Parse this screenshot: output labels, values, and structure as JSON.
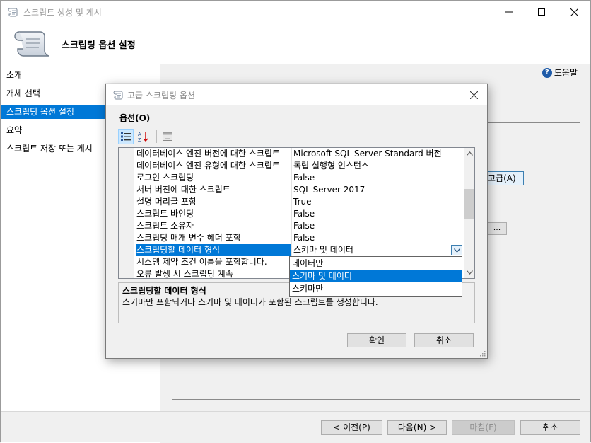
{
  "window": {
    "title": "스크립트 생성 및 게시",
    "header_title": "스크립팅 옵션 설정"
  },
  "nav": {
    "items": [
      {
        "label": "소개",
        "selected": false
      },
      {
        "label": "개체 선택",
        "selected": false
      },
      {
        "label": "스크립팅 옵션 설정",
        "selected": true
      },
      {
        "label": "요약",
        "selected": false
      },
      {
        "label": "스크립트 저장 또는 게시",
        "selected": false
      }
    ]
  },
  "help": {
    "label": "도움말"
  },
  "background": {
    "advanced_button": "고급(A)",
    "dots_button": "..."
  },
  "footer": {
    "prev": "< 이전(P)",
    "next": "다음(N) >",
    "finish": "마침(F)",
    "cancel": "취소"
  },
  "dialog": {
    "title": "고급 스크립팅 옵션",
    "options_label": "옵션(O)",
    "rows": [
      {
        "name": "데이터베이스 엔진 버전에 대한 스크립트",
        "value": "Microsoft SQL Server Standard 버전"
      },
      {
        "name": "데이터베이스 엔진 유형에 대한 스크립트",
        "value": "독립 실행형 인스턴스"
      },
      {
        "name": "로그인 스크립팅",
        "value": "False"
      },
      {
        "name": "서버 버전에 대한 스크립트",
        "value": "SQL Server 2017"
      },
      {
        "name": "설명 머리글 포함",
        "value": "True"
      },
      {
        "name": "스크립트 바인딩",
        "value": "False"
      },
      {
        "name": "스크립트 소유자",
        "value": "False"
      },
      {
        "name": "스크립팅 매개 변수 헤더 포함",
        "value": "False"
      },
      {
        "name": "스크립팅할 데이터 형식",
        "value": "스키마 및 데이터",
        "selected": true
      },
      {
        "name": "시스템 제약 조건 이름을 포함합니다.",
        "value": ""
      },
      {
        "name": "오류 발생 시 스크립팅 계속",
        "value": ""
      }
    ],
    "dropdown_options": [
      {
        "label": "데이터만",
        "selected": false
      },
      {
        "label": "스키마 및 데이터",
        "selected": true
      },
      {
        "label": "스키마만",
        "selected": false
      }
    ],
    "description": {
      "title": "스크립팅할 데이터 형식",
      "text": "스키마만 포함되거나 스키마 및 데이터가 포함된 스크립트를 생성합니다."
    },
    "ok": "확인",
    "cancel": "취소"
  }
}
